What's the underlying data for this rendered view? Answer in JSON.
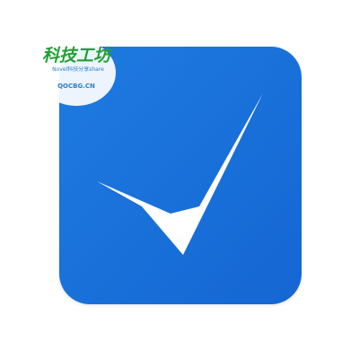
{
  "app_icon": {
    "icon": "checkmark-icon",
    "background_color": "#1a73e8",
    "checkmark_color": "#ffffff"
  },
  "watermark": {
    "title": "科技工坊",
    "subtitle": "Novel科技分享share",
    "domain": "QOCBG.CN",
    "title_color": "#22a035",
    "text_color": "#2a7fc9"
  }
}
